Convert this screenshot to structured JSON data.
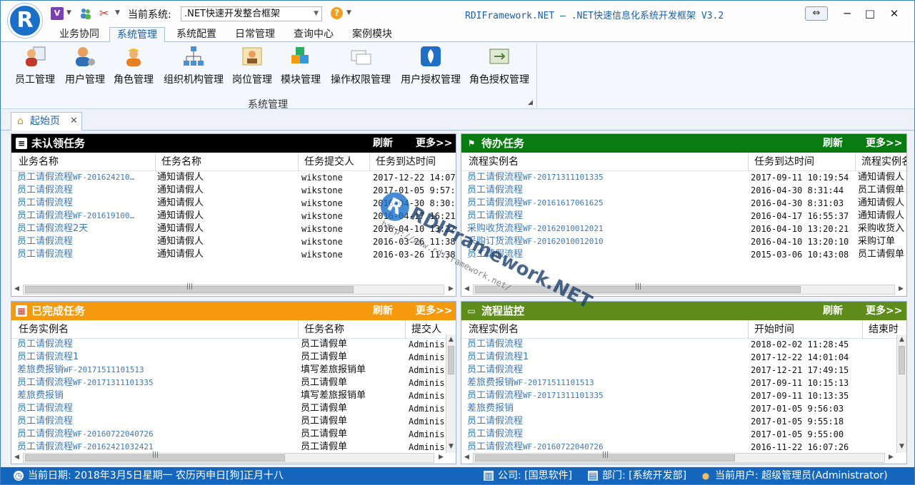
{
  "titlebar": {
    "current_system_label": "当前系统:",
    "current_system_value": ".NET快速开发整合框架",
    "app_title": "RDIFramework.NET — .NET快速信息化系统开发框架 V3.2",
    "minimize": "─",
    "maximize": "□",
    "close": "✕"
  },
  "menu_tabs": [
    "业务协同",
    "系统管理",
    "系统配置",
    "日常管理",
    "查询中心",
    "案例模块"
  ],
  "ribbon": {
    "buttons": [
      "员工管理",
      "用户管理",
      "角色管理",
      "组织机构管理",
      "岗位管理",
      "模块管理",
      "操作权限管理",
      "用户授权管理",
      "角色授权管理"
    ],
    "group_label": "系统管理"
  },
  "doc_tab": {
    "label": "起始页",
    "close": "✕"
  },
  "panels": {
    "unclaimed": {
      "title": "未认领任务",
      "refresh": "刷新",
      "more": "更多>>",
      "color": "#000000",
      "columns": [
        "业务名称",
        "任务名称",
        "任务提交人",
        "任务到达时间"
      ],
      "rows": [
        {
          "name": "员工请假流程",
          "code": "WF-201624210…",
          "task": "通知请假人",
          "user": "wikstone",
          "time": "2017-12-22 14:07:"
        },
        {
          "name": "员工请假流程",
          "code": "",
          "task": "通知请假人",
          "user": "wikstone",
          "time": "2017-01-05 9:57:2"
        },
        {
          "name": "员工请假流程",
          "code": "",
          "task": "通知请假人",
          "user": "wikstone",
          "time": "2016-04-30 8:30:5"
        },
        {
          "name": "员工请假流程",
          "code": "WF-201619100…",
          "task": "通知请假人",
          "user": "wikstone",
          "time": "2016-04-17 16:21:"
        },
        {
          "name": "员工请假流程2天",
          "code": "",
          "task": "通知请假人",
          "user": "wikstone",
          "time": "2016-04-10 13:22:"
        },
        {
          "name": "员工请假流程",
          "code": "",
          "task": "通知请假人",
          "user": "wikstone",
          "time": "2016-03-26 11:38:"
        },
        {
          "name": "员工请假流程",
          "code": "",
          "task": "通知请假人",
          "user": "wikstone",
          "time": "2016-03-26 11:38:"
        }
      ]
    },
    "todo": {
      "title": "待办任务",
      "refresh": "刷新",
      "more": "更多>>",
      "color": "#0a7a12",
      "columns": [
        "流程实例名",
        "任务到达时间",
        "流程实例名"
      ],
      "rows": [
        {
          "name": "员工请假流程",
          "code": "WF-20171311101335",
          "time": "2017-09-11 10:19:54",
          "extra": "通知请假人"
        },
        {
          "name": "员工请假流程",
          "code": "",
          "time": "2016-04-30 8:31:44",
          "extra": "员工请假单"
        },
        {
          "name": "员工请假流程",
          "code": "WF-20161617061625",
          "time": "2016-04-30 8:31:03",
          "extra": "通知请假人"
        },
        {
          "name": "员工请假流程",
          "code": "",
          "time": "2016-04-17 16:55:37",
          "extra": "通知请假人"
        },
        {
          "name": "采购收货流程",
          "code": "WF-20162010012021",
          "time": "2016-04-10 13:20:21",
          "extra": "采购收货入"
        },
        {
          "name": "采购订货流程",
          "code": "WF-20162010012010",
          "time": "2016-04-10 13:20:10",
          "extra": "采购订单"
        },
        {
          "name": "员工请假流程",
          "code": "",
          "time": "2015-03-06 10:43:08",
          "extra": "员工请假单"
        }
      ]
    },
    "completed": {
      "title": "已完成任务",
      "refresh": "刷新",
      "more": "更多>>",
      "color": "#f59a0c",
      "columns": [
        "任务实例名",
        "任务名称",
        "提交人"
      ],
      "rows": [
        {
          "name": "员工请假流程",
          "code": "",
          "task": "员工请假单",
          "user": "Adminis"
        },
        {
          "name": "员工请假流程1",
          "code": "",
          "task": "员工请假单",
          "user": "Adminis"
        },
        {
          "name": "差旅费报销",
          "code": "WF-20171511101513",
          "task": "填写差旅报销单",
          "user": "Adminis"
        },
        {
          "name": "员工请假流程",
          "code": "WF-20171311101335",
          "task": "员工请假单",
          "user": "Adminis"
        },
        {
          "name": "差旅费报销",
          "code": "",
          "task": "填写差旅报销单",
          "user": "Adminis"
        },
        {
          "name": "员工请假流程",
          "code": "",
          "task": "员工请假单",
          "user": "Adminis"
        },
        {
          "name": "员工请假流程",
          "code": "",
          "task": "员工请假单",
          "user": "Adminis"
        },
        {
          "name": "员工请假流程",
          "code": "WF-20160722040726",
          "task": "员工请假单",
          "user": "Adminis"
        },
        {
          "name": "员工请假流程",
          "code": "WF-20162421032421",
          "task": "员工请假单",
          "user": "Adminis"
        }
      ]
    },
    "monitor": {
      "title": "流程监控",
      "refresh": "刷新",
      "more": "更多>>",
      "color": "#5e8d1c",
      "columns": [
        "流程实例名",
        "开始时间",
        "结束时"
      ],
      "rows": [
        {
          "name": "员工请假流程",
          "code": "",
          "time": "2018-02-02 11:28:45"
        },
        {
          "name": "员工请假流程1",
          "code": "",
          "time": "2017-12-22 14:01:04"
        },
        {
          "name": "员工请假流程",
          "code": "",
          "time": "2017-12-21 17:49:15"
        },
        {
          "name": "差旅费报销",
          "code": "WF-20171511101513",
          "time": "2017-09-11 10:15:13"
        },
        {
          "name": "员工请假流程",
          "code": "WF-20171311101335",
          "time": "2017-09-11 10:13:35"
        },
        {
          "name": "差旅费报销",
          "code": "",
          "time": "2017-01-05 9:56:03"
        },
        {
          "name": "员工请假流程",
          "code": "",
          "time": "2017-01-05 9:55:18"
        },
        {
          "name": "员工请假流程",
          "code": "",
          "time": "2017-01-05 9:55:00"
        },
        {
          "name": "员工请假流程",
          "code": "WF-20160722040726",
          "time": "2016-11-22 16:07:26"
        }
      ]
    }
  },
  "watermark": {
    "brand": "RDIFramework.NET",
    "url": "http://www.rdiframework.net/"
  },
  "statusbar": {
    "date": "当前日期: 2018年3月5日星期一 农历丙申日[狗]正月十八",
    "company": "公司: [国思软件]",
    "department": "部门: [系统开发部]",
    "user": "当前用户: 超级管理员(Administrator)"
  }
}
